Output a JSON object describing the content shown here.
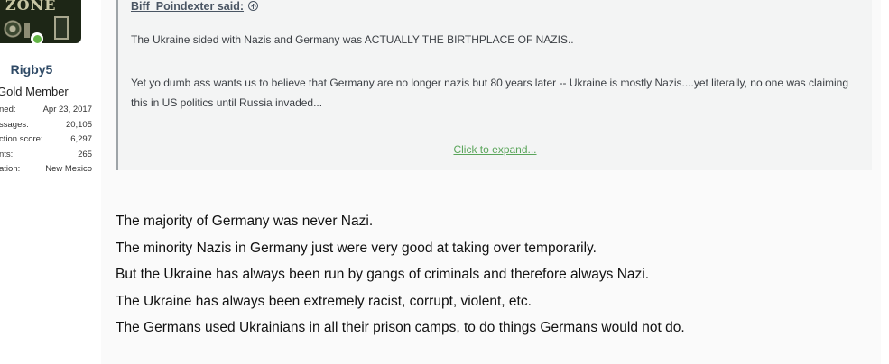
{
  "user": {
    "avatar_label": "ZONE",
    "name": "Rigby5",
    "title": "Gold Member",
    "stats": [
      {
        "key": "ned:",
        "value": "Apr 23, 2017"
      },
      {
        "key": "ssages:",
        "value": "20,105"
      },
      {
        "key": "ction score:",
        "value": "6,297"
      },
      {
        "key": "nts:",
        "value": "265"
      },
      {
        "key": "ation:",
        "value": "New Mexico"
      }
    ]
  },
  "quote": {
    "author_said": "Biff_Poindexter said:",
    "line1": "The Ukraine sided with Nazis and Germany was ACTUALLY THE BIRTHPLACE OF NAZIS..",
    "line2": "Yet yo dumb ass wants us to believe that Germany are no longer nazis but 80 years later -- Ukraine is mostly Nazis....yet literally, no one was claiming this in US politics until Russia invaded...",
    "expand_label": "Click to expand..."
  },
  "post": {
    "lines": [
      "The majority of Germany was never Nazi.",
      "The minority Nazis in Germany just were very good at taking over temporarily.",
      "But the Ukraine has always been run by gangs of criminals and therefore always Nazi.",
      "The Ukraine has always been extremely racist, corrupt, violent, etc.",
      "The Germans used Ukrainians in all their prison camps, to do things Germans would not do."
    ]
  }
}
